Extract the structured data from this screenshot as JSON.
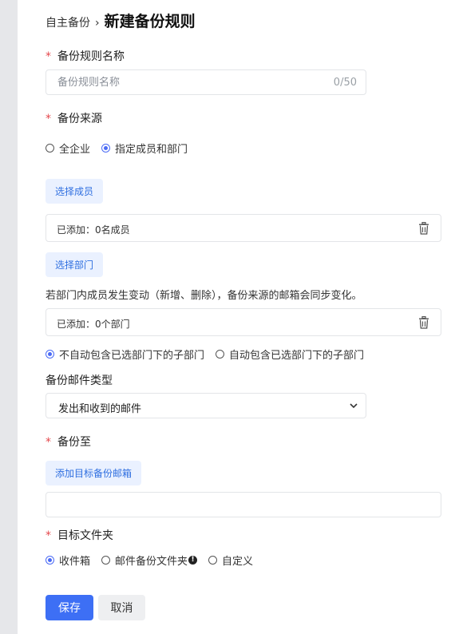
{
  "breadcrumb": {
    "parent": "自主备份",
    "separator": "›",
    "title": "新建备份规则"
  },
  "rule_name": {
    "required_mark": "*",
    "label": "备份规则名称",
    "placeholder": "备份规则名称",
    "value": "",
    "counter": "0/50"
  },
  "source": {
    "required_mark": "*",
    "label": "备份来源",
    "options": [
      {
        "label": "全企业",
        "selected": false
      },
      {
        "label": "指定成员和部门",
        "selected": true
      }
    ],
    "select_members_button": "选择成员",
    "members_added": "已添加：0名成员",
    "select_departments_button": "选择部门",
    "hint": "若部门内成员发生变动（新增、删除），备份来源的邮箱会同步变化。",
    "departments_added": "已添加：0个部门",
    "subdept_options": [
      {
        "label": "不自动包含已选部门下的子部门",
        "selected": true
      },
      {
        "label": "自动包含已选部门下的子部门",
        "selected": false
      }
    ]
  },
  "mail_type": {
    "label": "备份邮件类型",
    "selected": "发出和收到的邮件"
  },
  "backup_to": {
    "required_mark": "*",
    "label": "备份至",
    "add_button": "添加目标备份邮箱",
    "value": ""
  },
  "target_folder": {
    "required_mark": "*",
    "label": "目标文件夹",
    "options": [
      {
        "label": "收件箱",
        "selected": true
      },
      {
        "label": "邮件备份文件夹",
        "selected": false
      },
      {
        "label": "自定义",
        "selected": false
      }
    ],
    "info_mark": "!"
  },
  "actions": {
    "save": "保存",
    "cancel": "取消"
  },
  "colors": {
    "accent": "#3d6ff5",
    "required": "#e5484d",
    "light_button_bg": "#eaf1ff"
  },
  "icons": {
    "trash": "trash-icon",
    "chevron": "chevron-down-icon",
    "info": "info-icon"
  }
}
